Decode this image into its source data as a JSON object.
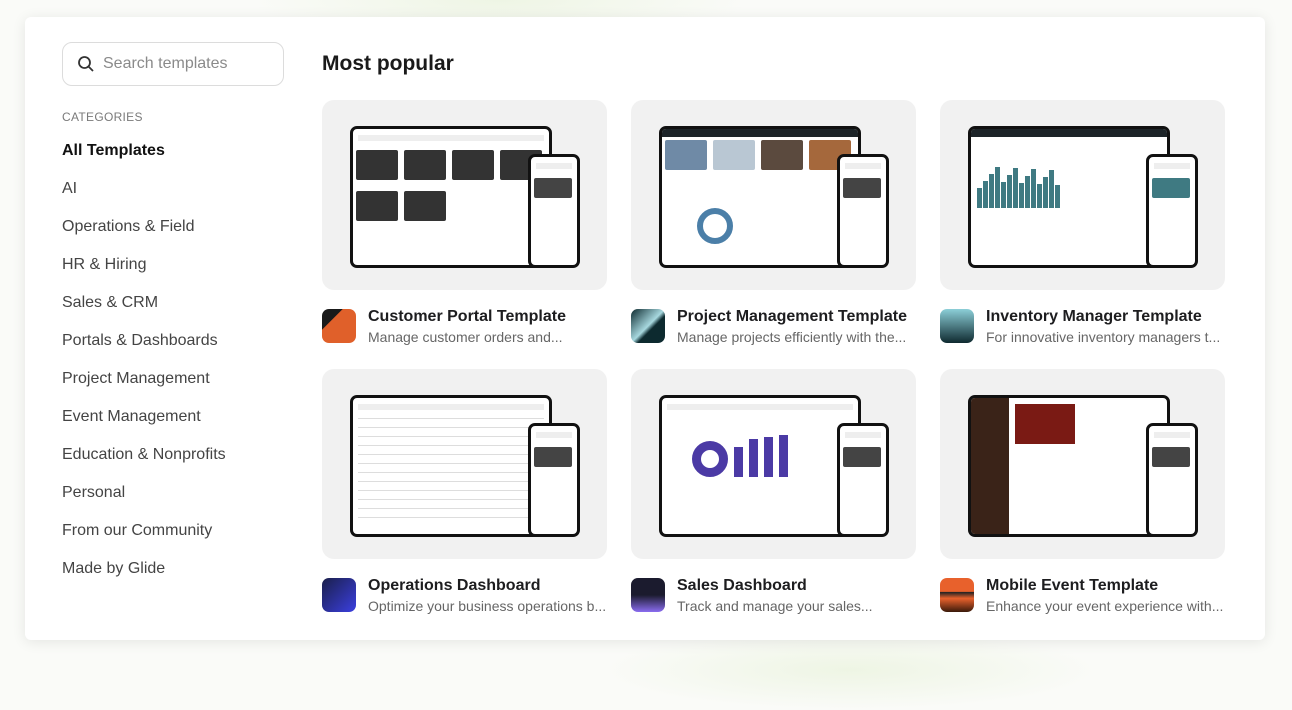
{
  "search": {
    "placeholder": "Search templates"
  },
  "sidebar": {
    "categories_label": "CATEGORIES",
    "items": [
      {
        "label": "All Templates",
        "active": true
      },
      {
        "label": "AI"
      },
      {
        "label": "Operations & Field"
      },
      {
        "label": "HR & Hiring"
      },
      {
        "label": "Sales & CRM"
      },
      {
        "label": "Portals & Dashboards"
      },
      {
        "label": "Project Management"
      },
      {
        "label": "Event Management"
      },
      {
        "label": "Education & Nonprofits"
      },
      {
        "label": "Personal"
      },
      {
        "label": "From our Community"
      },
      {
        "label": "Made by Glide"
      }
    ]
  },
  "main": {
    "heading": "Most popular",
    "templates": [
      {
        "title": "Customer Portal Template",
        "description": "Manage customer orders and...",
        "icon": "customer-portal-icon",
        "color": "#e0602a"
      },
      {
        "title": "Project Management Template",
        "description": "Manage projects efficiently with the...",
        "icon": "project-management-icon",
        "color": "#0f2a30"
      },
      {
        "title": "Inventory Manager Template",
        "description": "For innovative inventory managers t...",
        "icon": "inventory-manager-icon",
        "color": "#0f2a30"
      },
      {
        "title": "Operations Dashboard",
        "description": "Optimize your business operations b...",
        "icon": "operations-dashboard-icon",
        "color": "#3b3fe0"
      },
      {
        "title": "Sales Dashboard",
        "description": "Track and manage your sales...",
        "icon": "sales-dashboard-icon",
        "color": "#7b5fe0"
      },
      {
        "title": "Mobile Event Template",
        "description": "Enhance your event experience with...",
        "icon": "mobile-event-icon",
        "color": "#e8612c"
      }
    ]
  }
}
